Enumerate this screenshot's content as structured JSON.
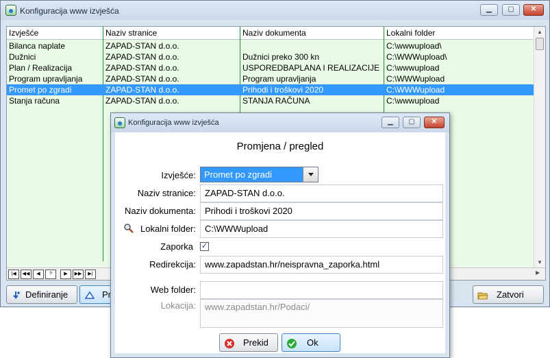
{
  "main_window": {
    "title": "Konfiguracija www izvješća",
    "controls": {
      "minimize": "▁",
      "maximize": "▢",
      "close": "✕"
    },
    "grid": {
      "columns": [
        "Izvješće",
        "Naziv stranice",
        "Naziv dokumenta",
        "Lokalni folder"
      ],
      "rows": [
        [
          "Bilanca naplate",
          "ZAPAD-STAN d.o.o.",
          "",
          "C:\\wwwupload\\"
        ],
        [
          "Dužnici",
          "ZAPAD-STAN d.o.o.",
          "Dužnici preko 300 kn",
          "C:\\WWWupload\\"
        ],
        [
          "Plan / Realizacija",
          "ZAPAD-STAN d.o.o.",
          "USPOREDBAPLANA I REALIZACIJE",
          "C:\\wwwupload"
        ],
        [
          "Program upravljanja",
          "ZAPAD-STAN d.o.o.",
          "Program upravljanja",
          "C:\\WWWupload"
        ],
        [
          "Promet po zgradi",
          "ZAPAD-STAN d.o.o.",
          "Prihodi i troškovi 2020",
          "C:\\WWWupload"
        ],
        [
          "Stanja računa",
          "ZAPAD-STAN d.o.o.",
          "STANJA RAČUNA",
          "C:\\wwwupload"
        ]
      ],
      "selected_row": 4,
      "nav_buttons": [
        "|◀",
        "◀◀",
        "◀",
        "?",
        "▶",
        "▶▶",
        "▶|"
      ]
    },
    "buttons": {
      "definiranje": "Definiranje",
      "promjena": "Promjena",
      "zatvori": "Zatvori"
    }
  },
  "dialog": {
    "title": "Konfiguracija www izvješća",
    "heading": "Promjena / pregled",
    "labels": {
      "izvjesce": "Izvješće:",
      "naziv_stranice": "Naziv stranice:",
      "naziv_dokumenta": "Naziv dokumenta:",
      "lokalni_folder": "Lokalni folder:",
      "zaporka": "Zaporka",
      "redirekcija": "Redirekcija:",
      "web_folder": "Web folder:",
      "lokacija": "Lokacija:"
    },
    "values": {
      "izvjesce": "Promet po zgradi",
      "naziv_stranice": "ZAPAD-STAN d.o.o.",
      "naziv_dokumenta": "Prihodi i troškovi 2020",
      "lokalni_folder": "C:\\WWWupload",
      "zaporka_checked": "✓",
      "redirekcija": "www.zapadstan.hr/neispravna_zaporka.html",
      "web_folder": "",
      "lokacija": "www.zapadstan.hr/Podaci/"
    },
    "buttons": {
      "prekid": "Prekid",
      "ok": "Ok"
    }
  }
}
